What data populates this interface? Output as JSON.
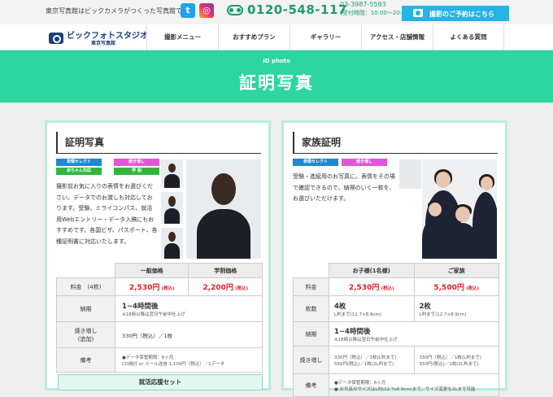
{
  "topbar": {
    "tagline": "東京写真館はビックカメラがつくった写真館です。",
    "twitter_glyph": "t",
    "instagram_glyph": "◎",
    "phone": "0120-548-117",
    "phone2": "03-3987-5593",
    "hours": "(受付時間：10:00〜20:00)",
    "booking_label": "撮影のご予約はこちら"
  },
  "logo": {
    "name": "ビックフォトスタジオ",
    "sub": "東京写真館"
  },
  "nav": {
    "items": [
      "撮影メニュー",
      "おすすめプラン",
      "ギャラリー",
      "アクセス・店舗情報",
      "よくある質問"
    ]
  },
  "hero": {
    "en": "ID photo",
    "title": "証明写真"
  },
  "left_card": {
    "title": "証明写真",
    "tags": [
      "表情セレクト",
      "焼き増し",
      "赤ちゃん対応",
      "学 割"
    ],
    "description": "撮影前お気に入りの表情をお選びください。データでのお渡しも対応しております。受験、ミライコンパス、就活用Webエントリー・データ入稿にもおすすめです。各国ビザ、パスポート、各種証明書に対応いたします。",
    "table": {
      "col_general": "一般価格",
      "col_student": "学割価格",
      "row_fee_label": "料金　(4枚)",
      "general_price": "2,530円",
      "student_price": "2,200円",
      "tax": "(税込)",
      "row_delivery_label": "納期",
      "delivery_main": "1~4時間後",
      "delivery_note": "※18時以降は翌日午前中仕上げ",
      "row_reprint_label_1": "焼き増し",
      "row_reprint_label_2": "(追加)",
      "reprint_value": "330円（税込）／1枚",
      "row_remarks_label": "備考",
      "remarks_1": "●データ保管期限：6ヶ月",
      "remarks_2": "CD焼付 or メール送信 1,100円（税込）／1データ"
    },
    "set_title": "就活応援セット"
  },
  "right_card": {
    "title": "家族証明",
    "tags": [
      "表情セレクト",
      "焼き増し"
    ],
    "description": "受験・進級用のお写真に。表情をその場で確認できるので、納得のいく一枚を、お選びいただけます。",
    "table": {
      "col_child": "お子様(1名様)",
      "col_family": "ご家族",
      "row_fee_label": "料金",
      "child_price": "2,530円",
      "family_price": "5,500円",
      "tax": "(税込)",
      "row_count_label": "枚数",
      "child_count": "4枚",
      "child_count_note": "L判まで(12.7×8.9cm)",
      "family_count": "2枚",
      "family_count_note": "L判まで(12.7×8.9cm)",
      "row_delivery_label": "納期",
      "delivery_main": "1~4時間後",
      "delivery_note": "※18時以降は翌日午前中仕上げ",
      "row_reprint_label": "焼き増し",
      "child_reprint_1": "330円（税込）／1枚(L判まで)",
      "child_reprint_2": "550円(税込)／1枚(2L判まで)",
      "family_reprint_1": "330円（税込）／1枚(L判まで)",
      "family_reprint_2": "550円(税込)／1枚(2L判まで)",
      "row_remarks_label": "備考",
      "remarks_1": "●データ保管期限：6ヶ月",
      "remarks_2": "● お写真のサイズはL判(12.7x8.9cm)まで。サイズ変更も2Lまで可能"
    }
  },
  "colors": {
    "accent_green": "#2bd6a0",
    "brand_navy": "#1b3f7a",
    "price_red": "#e0202a",
    "booking_blue": "#27b3e3"
  }
}
